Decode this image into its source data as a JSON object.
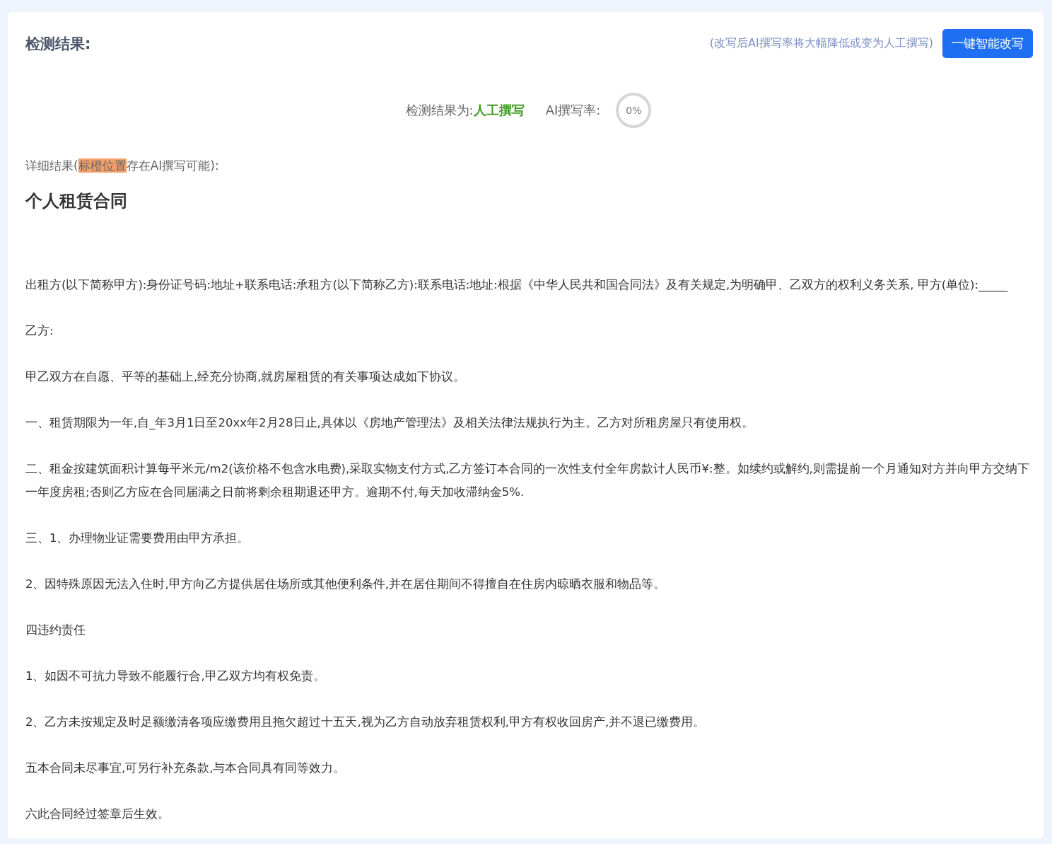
{
  "header": {
    "title": "检测结果:",
    "hint": "(改写后AI撰写率将大幅降低或变为人工撰写)",
    "rewrite_button": "一键智能改写"
  },
  "result": {
    "label": "检测结果为:",
    "verdict": "人工撰写",
    "rate_label": "AI撰写率:",
    "rate": "0%",
    "level": 0
  },
  "detail": {
    "prefix": "详细结果(",
    "highlight": "标橙位置",
    "suffix": "存在AI撰写可能):"
  },
  "document": {
    "title": "个人租赁合同",
    "paragraphs": [
      "出租方(以下简称甲方):身份证号码:地址+联系电话:承租方(以下简称乙方):联系电话:地址:根据《中华人民共和国合同法》及有关规定,为明确甲、乙双方的权利义务关系, 甲方(单位):_____",
      "乙方:",
      "甲乙双方在自愿、平等的基础上,经充分协商,就房屋租赁的有关事项达成如下协议。",
      "一、租赁期限为一年,自_年3月1日至20xx年2月28日止,具体以《房地产管理法》及相关法律法规执行为主。乙方对所租房屋只有使用权。",
      "二、租金按建筑面积计算每平米元/m2(该价格不包含水电费),采取实物支付方式,乙方签订本合同的一次性支付全年房款计人民币¥:整。如续约或解约,则需提前一个月通知对方并向甲方交纳下一年度房租;否则乙方应在合同届满之日前将剩余租期退还甲方。逾期不付,每天加收滞纳金5%.",
      "三、1、办理物业证需要费用由甲方承担。",
      "2、因特殊原因无法入住时,甲方向乙方提供居住场所或其他便利条件,并在居住期间不得擅自在住房内晾晒衣服和物品等。",
      "四违约责任",
      "1、如因不可抗力导致不能履行合,甲乙双方均有权免责。",
      "2、乙方未按规定及时足额缴清各项应缴费用且拖欠超过十五天,视为乙方自动放弃租赁权利,甲方有权收回房产,并不退已缴费用。",
      "五本合同未尽事宜,可另行补充条款,与本合同具有同等效力。",
      "六此合同经过签章后生效。"
    ]
  }
}
